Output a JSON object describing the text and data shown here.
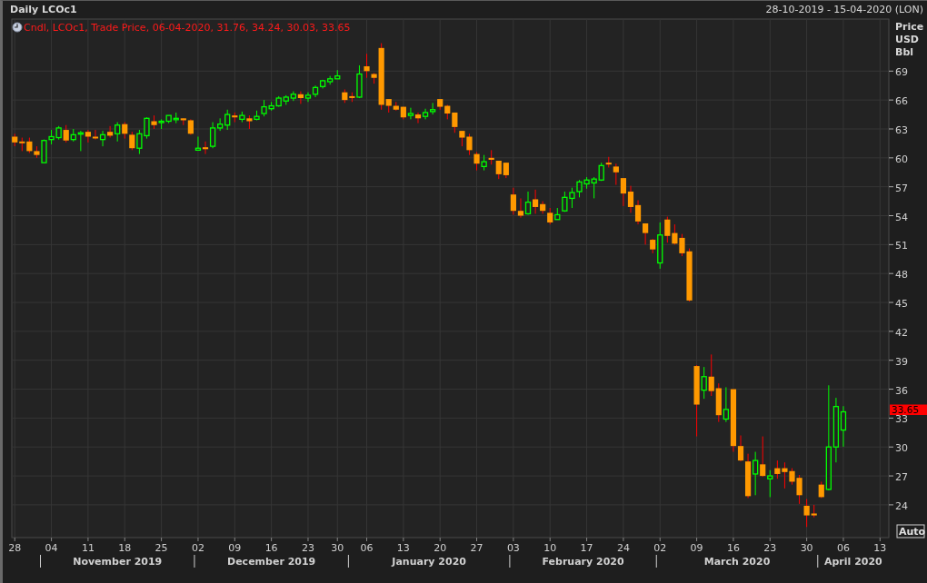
{
  "header": {
    "title": "Daily LCOc1",
    "range": "28-10-2019 - 15-04-2020 (LON)"
  },
  "legend": "Cndl, LCOc1, Trade Price, 06-04-2020, 31.76, 34.24, 30.03, 33.65",
  "unit_lines": [
    "Price",
    "USD",
    "Bbl"
  ],
  "last_price_tag": "33.65",
  "auto_button": "Auto",
  "chart_data": {
    "type": "candlestick",
    "categories": [
      "28",
      null,
      null,
      null,
      null,
      "04",
      null,
      null,
      null,
      null,
      "11",
      null,
      null,
      null,
      null,
      "18",
      null,
      null,
      null,
      null,
      "25",
      null,
      null,
      null,
      null,
      "02",
      null,
      null,
      null,
      null,
      "09",
      null,
      null,
      null,
      null,
      "16",
      null,
      null,
      null,
      null,
      "23",
      null,
      null,
      null,
      "30",
      null,
      null,
      null,
      "06",
      null,
      null,
      null,
      null,
      "13",
      null,
      null,
      null,
      null,
      "20",
      null,
      null,
      null,
      null,
      "27",
      null,
      null,
      null,
      null,
      "03",
      null,
      null,
      null,
      null,
      "10",
      null,
      null,
      null,
      null,
      "17",
      null,
      null,
      null,
      null,
      "24",
      null,
      null,
      null,
      null,
      "02",
      null,
      null,
      null,
      null,
      "09",
      null,
      null,
      null,
      null,
      "16",
      null,
      null,
      null,
      null,
      "23",
      null,
      null,
      null,
      null,
      "30",
      null,
      null,
      null,
      null,
      "06",
      null,
      null,
      null,
      null,
      "13"
    ],
    "ohlc": [
      [
        62.2,
        62.5,
        61.2,
        61.6
      ],
      [
        61.7,
        62.1,
        60.7,
        61.6
      ],
      [
        61.7,
        62.1,
        60.5,
        60.7
      ],
      [
        60.7,
        61.2,
        60.0,
        60.3
      ],
      [
        59.5,
        61.9,
        59.5,
        61.8
      ],
      [
        61.9,
        62.9,
        61.4,
        62.2
      ],
      [
        62.1,
        63.3,
        61.9,
        63.1
      ],
      [
        62.9,
        63.4,
        61.6,
        61.8
      ],
      [
        61.9,
        63.0,
        61.7,
        62.4
      ],
      [
        62.5,
        62.8,
        60.7,
        62.6
      ],
      [
        62.7,
        62.9,
        61.6,
        62.2
      ],
      [
        62.2,
        62.9,
        61.9,
        62.1
      ],
      [
        61.9,
        62.8,
        61.2,
        62.4
      ],
      [
        62.7,
        63.3,
        62.1,
        62.3
      ],
      [
        62.5,
        63.7,
        61.7,
        63.4
      ],
      [
        63.5,
        63.7,
        62.0,
        62.5
      ],
      [
        62.4,
        62.7,
        60.8,
        61.0
      ],
      [
        61.0,
        62.9,
        60.4,
        62.5
      ],
      [
        62.3,
        64.2,
        62.0,
        64.1
      ],
      [
        63.8,
        64.4,
        63.0,
        63.4
      ],
      [
        63.7,
        64.0,
        63.0,
        63.8
      ],
      [
        63.8,
        64.4,
        63.6,
        64.4
      ],
      [
        64.1,
        64.7,
        63.6,
        64.1
      ],
      [
        64.1,
        64.1,
        63.4,
        63.9
      ],
      [
        63.9,
        64.0,
        62.4,
        62.5
      ],
      [
        60.8,
        62.2,
        60.8,
        61.0
      ],
      [
        61.1,
        61.7,
        60.4,
        60.9
      ],
      [
        61.2,
        63.7,
        61.0,
        63.1
      ],
      [
        63.1,
        64.1,
        62.8,
        63.5
      ],
      [
        63.4,
        65.0,
        62.9,
        64.5
      ],
      [
        64.4,
        64.7,
        63.7,
        64.2
      ],
      [
        64.0,
        64.8,
        63.7,
        64.4
      ],
      [
        64.1,
        64.4,
        63.0,
        63.8
      ],
      [
        64.0,
        64.9,
        63.9,
        64.3
      ],
      [
        64.6,
        66.0,
        64.3,
        65.3
      ],
      [
        65.1,
        65.8,
        64.9,
        65.4
      ],
      [
        65.4,
        66.4,
        65.3,
        66.2
      ],
      [
        65.9,
        66.5,
        65.5,
        66.3
      ],
      [
        66.2,
        66.9,
        65.9,
        66.6
      ],
      [
        66.6,
        66.9,
        65.6,
        66.2
      ],
      [
        66.2,
        66.8,
        65.8,
        66.5
      ],
      [
        66.6,
        67.5,
        66.3,
        67.3
      ],
      [
        67.4,
        68.1,
        67.2,
        68.0
      ],
      [
        67.9,
        68.5,
        67.6,
        68.2
      ],
      [
        68.2,
        69.1,
        68.2,
        68.5
      ],
      [
        66.8,
        67.1,
        65.7,
        66.0
      ],
      [
        66.4,
        66.8,
        65.8,
        66.3
      ],
      [
        66.3,
        69.6,
        66.2,
        68.7
      ],
      [
        69.5,
        70.8,
        68.3,
        69.0
      ],
      [
        68.7,
        68.8,
        67.7,
        68.3
      ],
      [
        71.4,
        71.9,
        65.0,
        65.5
      ],
      [
        66.1,
        66.1,
        64.7,
        65.4
      ],
      [
        65.4,
        65.8,
        64.9,
        65.0
      ],
      [
        65.3,
        65.3,
        64.0,
        64.2
      ],
      [
        64.4,
        65.2,
        64.0,
        64.6
      ],
      [
        64.5,
        64.7,
        63.6,
        64.1
      ],
      [
        64.3,
        65.1,
        64.0,
        64.7
      ],
      [
        64.8,
        65.7,
        64.5,
        65.0
      ],
      [
        66.1,
        66.1,
        65.0,
        65.3
      ],
      [
        65.4,
        65.5,
        64.0,
        64.6
      ],
      [
        64.7,
        64.7,
        62.6,
        63.2
      ],
      [
        62.8,
        62.8,
        61.2,
        62.1
      ],
      [
        62.2,
        62.5,
        60.3,
        60.8
      ],
      [
        60.4,
        60.6,
        58.7,
        59.4
      ],
      [
        59.1,
        60.3,
        58.7,
        59.6
      ],
      [
        60.0,
        60.8,
        59.3,
        59.8
      ],
      [
        59.7,
        59.7,
        57.8,
        58.3
      ],
      [
        59.5,
        59.5,
        57.9,
        58.2
      ],
      [
        56.2,
        56.9,
        54.1,
        54.5
      ],
      [
        54.5,
        55.8,
        53.8,
        54.0
      ],
      [
        54.2,
        56.5,
        54.1,
        55.4
      ],
      [
        55.7,
        56.7,
        54.2,
        54.9
      ],
      [
        55.2,
        55.5,
        54.2,
        54.5
      ],
      [
        54.3,
        54.8,
        53.1,
        53.3
      ],
      [
        53.6,
        54.8,
        53.6,
        54.1
      ],
      [
        54.5,
        56.5,
        54.4,
        55.9
      ],
      [
        55.8,
        56.9,
        54.8,
        56.4
      ],
      [
        56.5,
        57.7,
        55.9,
        57.5
      ],
      [
        57.3,
        58.0,
        56.8,
        57.7
      ],
      [
        57.4,
        58.0,
        55.8,
        57.8
      ],
      [
        57.7,
        59.5,
        57.6,
        59.2
      ],
      [
        59.5,
        60.1,
        59.0,
        59.4
      ],
      [
        59.1,
        59.4,
        57.2,
        58.5
      ],
      [
        57.9,
        57.9,
        55.0,
        56.3
      ],
      [
        56.5,
        57.1,
        54.3,
        54.9
      ],
      [
        55.1,
        55.6,
        53.1,
        53.4
      ],
      [
        53.2,
        53.2,
        51.0,
        52.2
      ],
      [
        51.5,
        51.6,
        50.1,
        50.5
      ],
      [
        49.1,
        53.3,
        48.5,
        52.0
      ],
      [
        53.6,
        53.9,
        51.2,
        51.9
      ],
      [
        52.2,
        53.1,
        51.0,
        51.1
      ],
      [
        51.7,
        52.1,
        49.8,
        50.1
      ],
      [
        50.3,
        50.6,
        45.1,
        45.2
      ],
      [
        38.4,
        38.5,
        31.1,
        34.4
      ],
      [
        35.9,
        38.3,
        35.0,
        37.3
      ],
      [
        37.3,
        39.6,
        35.3,
        35.8
      ],
      [
        36.1,
        36.6,
        32.6,
        33.3
      ],
      [
        32.9,
        36.2,
        32.6,
        33.9
      ],
      [
        36.0,
        36.0,
        29.5,
        30.1
      ],
      [
        30.1,
        31.2,
        28.5,
        28.6
      ],
      [
        28.5,
        29.3,
        24.7,
        24.9
      ],
      [
        27.2,
        29.5,
        25.0,
        28.6
      ],
      [
        28.2,
        31.1,
        26.9,
        27.0
      ],
      [
        26.7,
        27.6,
        24.8,
        27.0
      ],
      [
        27.8,
        28.6,
        26.7,
        27.2
      ],
      [
        27.8,
        28.4,
        25.7,
        27.4
      ],
      [
        27.5,
        27.8,
        26.1,
        26.4
      ],
      [
        26.8,
        27.1,
        24.1,
        25.0
      ],
      [
        23.9,
        24.6,
        21.7,
        22.9
      ],
      [
        23.1,
        24.0,
        22.7,
        22.9
      ],
      [
        26.1,
        26.4,
        24.7,
        24.8
      ],
      [
        25.6,
        36.4,
        25.5,
        30.0
      ],
      [
        30.0,
        35.1,
        28.4,
        34.2
      ],
      [
        31.76,
        34.24,
        30.03,
        33.65
      ],
      null,
      null,
      null,
      null,
      null
    ],
    "ylim": [
      20.6,
      74.4
    ],
    "yticks": [
      24,
      27,
      30,
      33,
      36,
      39,
      42,
      45,
      48,
      51,
      54,
      57,
      60,
      63,
      66,
      69
    ],
    "grid": true,
    "annotations": [
      "November 2019",
      "December 2019",
      "January 2020",
      "February 2020",
      "March 2020",
      "April 2020"
    ]
  }
}
